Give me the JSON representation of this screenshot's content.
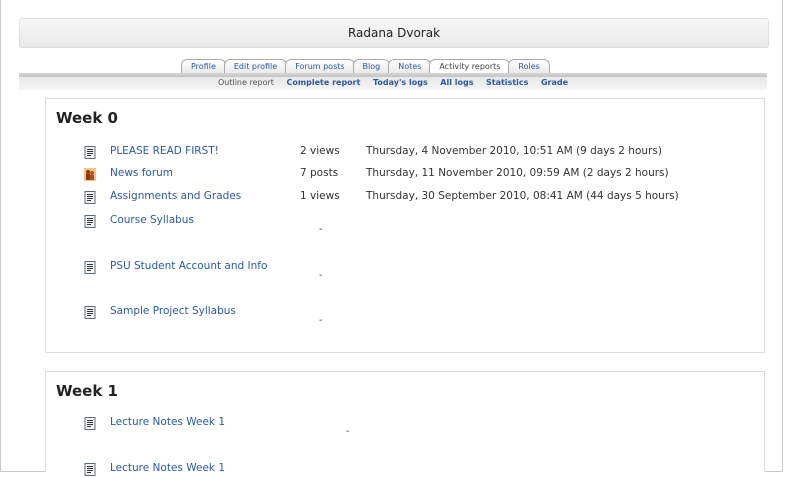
{
  "header": {
    "title": "Radana Dvorak"
  },
  "tabs": [
    {
      "label": "Profile"
    },
    {
      "label": "Edit profile"
    },
    {
      "label": "Forum posts"
    },
    {
      "label": "Blog"
    },
    {
      "label": "Notes"
    },
    {
      "label": "Activity reports",
      "active": true
    },
    {
      "label": "Roles"
    }
  ],
  "subtabs": [
    {
      "label": "Outline report",
      "current": true
    },
    {
      "label": "Complete report"
    },
    {
      "label": "Today's logs"
    },
    {
      "label": "All logs"
    },
    {
      "label": "Statistics"
    },
    {
      "label": "Grade"
    }
  ],
  "weeks": [
    {
      "title": "Week 0",
      "items": [
        {
          "icon": "document-icon",
          "name": "PLEASE READ FIRST!",
          "count": "2 views",
          "time": "Thursday, 4 November 2010, 10:51 AM (9 days 2 hours)"
        },
        {
          "icon": "forum-icon",
          "name": "News forum",
          "count": "7 posts",
          "time": "Thursday, 11 November 2010, 09:59 AM (2 days 2 hours)"
        },
        {
          "icon": "document-icon",
          "name": "Assignments and Grades",
          "count": "1 views",
          "time": "Thursday, 30 September 2010, 08:41 AM (44 days 5 hours)"
        },
        {
          "icon": "document-icon",
          "name": "Course Syllabus",
          "count": "-",
          "time": ""
        },
        {
          "icon": "document-icon",
          "name": "PSU Student Account and Info",
          "count": "-",
          "time": ""
        },
        {
          "icon": "document-icon",
          "name": "Sample Project Syllabus",
          "count": "-",
          "time": ""
        }
      ]
    },
    {
      "title": "Week 1",
      "items": [
        {
          "icon": "document-icon",
          "name": "Lecture Notes Week 1",
          "count": "-",
          "time": ""
        },
        {
          "icon": "document-icon",
          "name": "Lecture Notes Week 1",
          "count": "",
          "time": ""
        }
      ]
    }
  ]
}
